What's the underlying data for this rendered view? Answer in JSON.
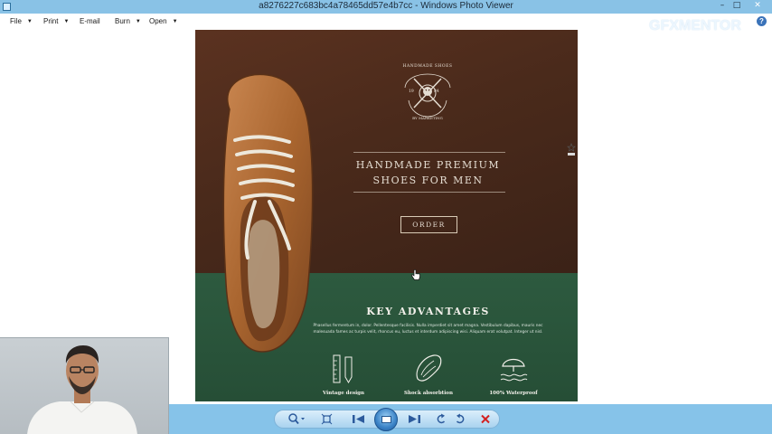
{
  "window": {
    "title": "a8276227c683bc4a78465dd57e4b7cc - Windows Photo Viewer",
    "minimize": "–",
    "maximize": "□",
    "close": "✕"
  },
  "menu": {
    "items": [
      {
        "label": "File",
        "has_dropdown": true
      },
      {
        "label": "Print",
        "has_dropdown": true
      },
      {
        "label": "E-mail",
        "has_dropdown": false
      },
      {
        "label": "Burn",
        "has_dropdown": true
      },
      {
        "label": "Open",
        "has_dropdown": true
      }
    ],
    "caret": "▼",
    "help_icon": "?"
  },
  "watermark": "GFXMENTOR",
  "photo": {
    "badge_top": "HANDMADE SHOES",
    "badge_year_left": "19",
    "badge_year_right": "84",
    "badge_bottom": "BY MARKETING",
    "headline_line1": "HANDMADE PREMIUM",
    "headline_line2": "SHOES FOR MEN",
    "order_label": "ORDER",
    "advantages_title": "KEY ADVANTAGES",
    "advantages_text": "Phasellus fermentum in, dolor. Pellentesque facilisis. Nulla imperdiet sit amet magna. Vestibulum dapibus, mauris nec malesuada fames ac turpis velit, rhoncus eu, luctus et interdum adipiscing wisi. Aliquam erat volutpat. Integer ut nisl.",
    "features": [
      {
        "label": "Vintage design",
        "icon": "ruler-pencil-icon"
      },
      {
        "label": "Shock absorbtion",
        "icon": "insole-icon"
      },
      {
        "label": "100% Waterproof",
        "icon": "umbrella-waves-icon"
      }
    ],
    "colors": {
      "brown": "#4a2a1b",
      "green": "#2d5a3f",
      "cream": "#e5ddd2"
    }
  },
  "toolbar": {
    "zoom": "zoom-icon",
    "actual_size": "fit-window-icon",
    "previous": "previous-icon",
    "slideshow": "slideshow-icon",
    "next": "next-icon",
    "rotate_ccw": "rotate-counterclockwise-icon",
    "rotate_cw": "rotate-clockwise-icon",
    "delete": "delete-icon"
  }
}
